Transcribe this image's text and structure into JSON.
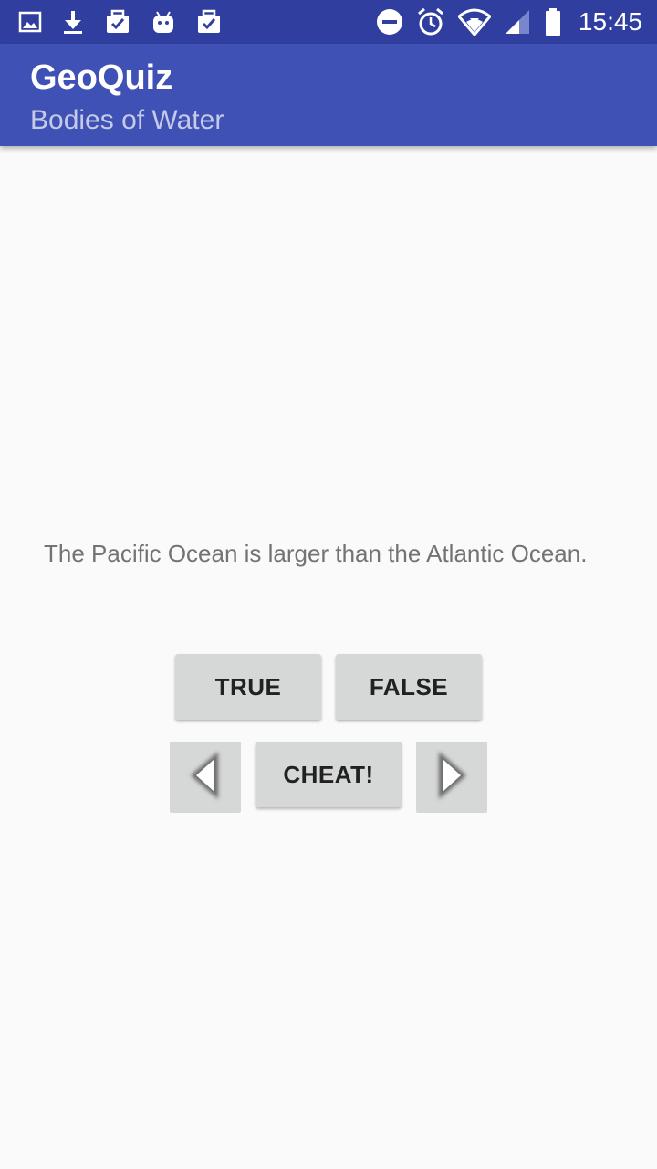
{
  "status_bar": {
    "time": "15:45",
    "left_icons": [
      "image-icon",
      "download-icon",
      "briefcase-check-icon",
      "android-icon",
      "briefcase-check-icon"
    ],
    "right_icons": [
      "do-not-disturb-icon",
      "alarm-icon",
      "wifi-icon",
      "signal-icon",
      "battery-icon"
    ],
    "background": "#303f9f"
  },
  "app_bar": {
    "title": "GeoQuiz",
    "subtitle": "Bodies of Water",
    "background": "#3f51b5"
  },
  "question": {
    "text": "The Pacific Ocean is larger than the Atlantic Ocean."
  },
  "buttons": {
    "true_label": "TRUE",
    "false_label": "FALSE",
    "cheat_label": "CHEAT!",
    "prev_icon": "arrow-left-icon",
    "next_icon": "arrow-right-icon"
  }
}
